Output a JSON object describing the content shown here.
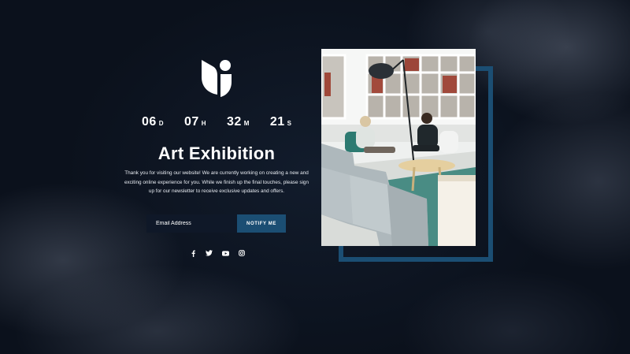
{
  "countdown": {
    "days": "06",
    "days_unit": "D",
    "hours": "07",
    "hours_unit": "H",
    "minutes": "32",
    "minutes_unit": "M",
    "seconds": "21",
    "seconds_unit": "S"
  },
  "title": "Art Exhibition",
  "description": "Thank you for visiting our website! We are currently working on creating a new and exciting online experience for you. While we finish up the final touches, please sign up for our newsletter to receive exclusive updates and offers.",
  "subscribe": {
    "placeholder": "Email Address",
    "button_label": "NOTIFY ME"
  },
  "social": [
    "facebook-icon",
    "twitter-icon",
    "youtube-icon",
    "instagram-icon"
  ],
  "colors": {
    "accent": "#1b4e73",
    "background": "#0d1421",
    "text": "#ffffff"
  }
}
